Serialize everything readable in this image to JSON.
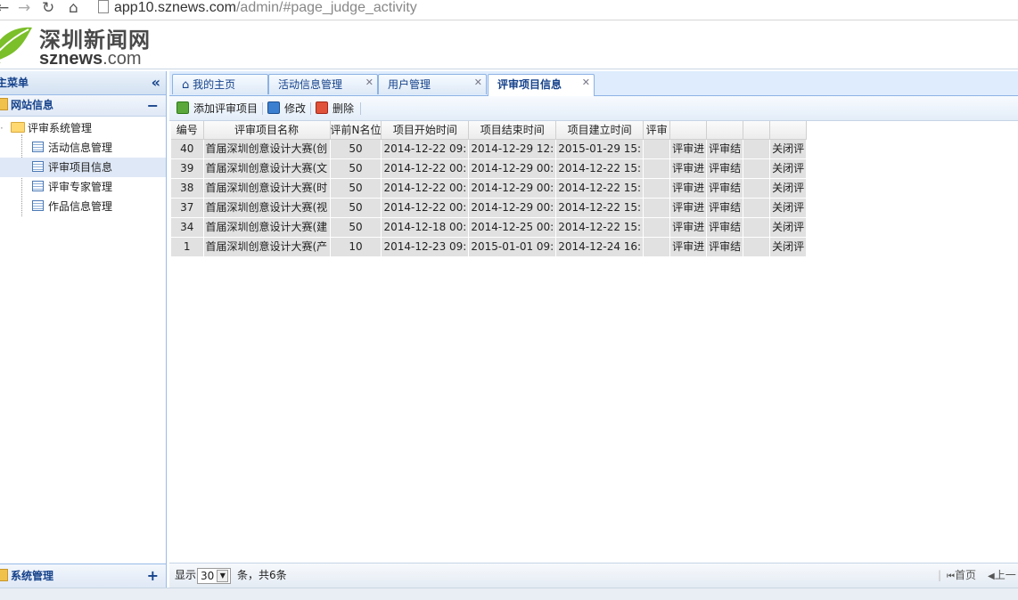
{
  "browser": {
    "url_host": "app10.sznews.com",
    "url_path": "/admin/#page_judge_activity"
  },
  "header": {
    "logo_cn": "深圳新闻网",
    "logo_en_bold": "sznews",
    "logo_en_light": ".com"
  },
  "sidebar": {
    "title": "主菜单",
    "collapse_icon": "«",
    "accordion_top": {
      "label": "网站信息",
      "toggle": "−"
    },
    "tree": {
      "root": "评审系统管理",
      "items": [
        "活动信息管理",
        "评审项目信息",
        "评审专家管理",
        "作品信息管理"
      ],
      "selected_index": 1
    },
    "accordion_bottom": {
      "label": "系统管理",
      "toggle": "+"
    }
  },
  "tabs": [
    {
      "label": "我的主页",
      "icon": "home-icon",
      "closable": false
    },
    {
      "label": "活动信息管理",
      "closable": true
    },
    {
      "label": "用户管理",
      "closable": true
    },
    {
      "label": "评审项目信息",
      "closable": true,
      "active": true
    }
  ],
  "toolbar": {
    "add_label": "添加评审项目",
    "edit_label": "修改",
    "delete_label": "删除"
  },
  "grid": {
    "headers": [
      "编号",
      "评审项目名称",
      "评前N名位",
      "项目开始时间",
      "项目结束时间",
      "项目建立时间",
      "评审",
      "",
      "",
      "",
      ""
    ],
    "rows": [
      [
        "40",
        "首届深圳创意设计大赛(创",
        "50",
        "2014-12-22 09:",
        "2014-12-29 12:",
        "2015-01-29 15:",
        "",
        "评审进",
        "评审结",
        "",
        "关闭评"
      ],
      [
        "39",
        "首届深圳创意设计大赛(文",
        "50",
        "2014-12-22 00:",
        "2014-12-29 00:",
        "2014-12-22 15:",
        "",
        "评审进",
        "评审结",
        "",
        "关闭评"
      ],
      [
        "38",
        "首届深圳创意设计大赛(时",
        "50",
        "2014-12-22 00:",
        "2014-12-29 00:",
        "2014-12-22 15:",
        "",
        "评审进",
        "评审结",
        "",
        "关闭评"
      ],
      [
        "37",
        "首届深圳创意设计大赛(视",
        "50",
        "2014-12-22 00:",
        "2014-12-29 00:",
        "2014-12-22 15:",
        "",
        "评审进",
        "评审结",
        "",
        "关闭评"
      ],
      [
        "34",
        "首届深圳创意设计大赛(建",
        "50",
        "2014-12-18 00:",
        "2014-12-25 00:",
        "2014-12-22 15:",
        "",
        "评审进",
        "评审结",
        "",
        "关闭评"
      ],
      [
        "1",
        "首届深圳创意设计大赛(产",
        "10",
        "2014-12-23 09:",
        "2015-01-01 09:",
        "2014-12-24 16:",
        "",
        "评审进",
        "评审结",
        "",
        "关闭评"
      ]
    ]
  },
  "pager": {
    "show_label": "显示",
    "page_size": "30",
    "total_text": "条，共6条",
    "first_label": "首页",
    "prev_label": "上一"
  }
}
